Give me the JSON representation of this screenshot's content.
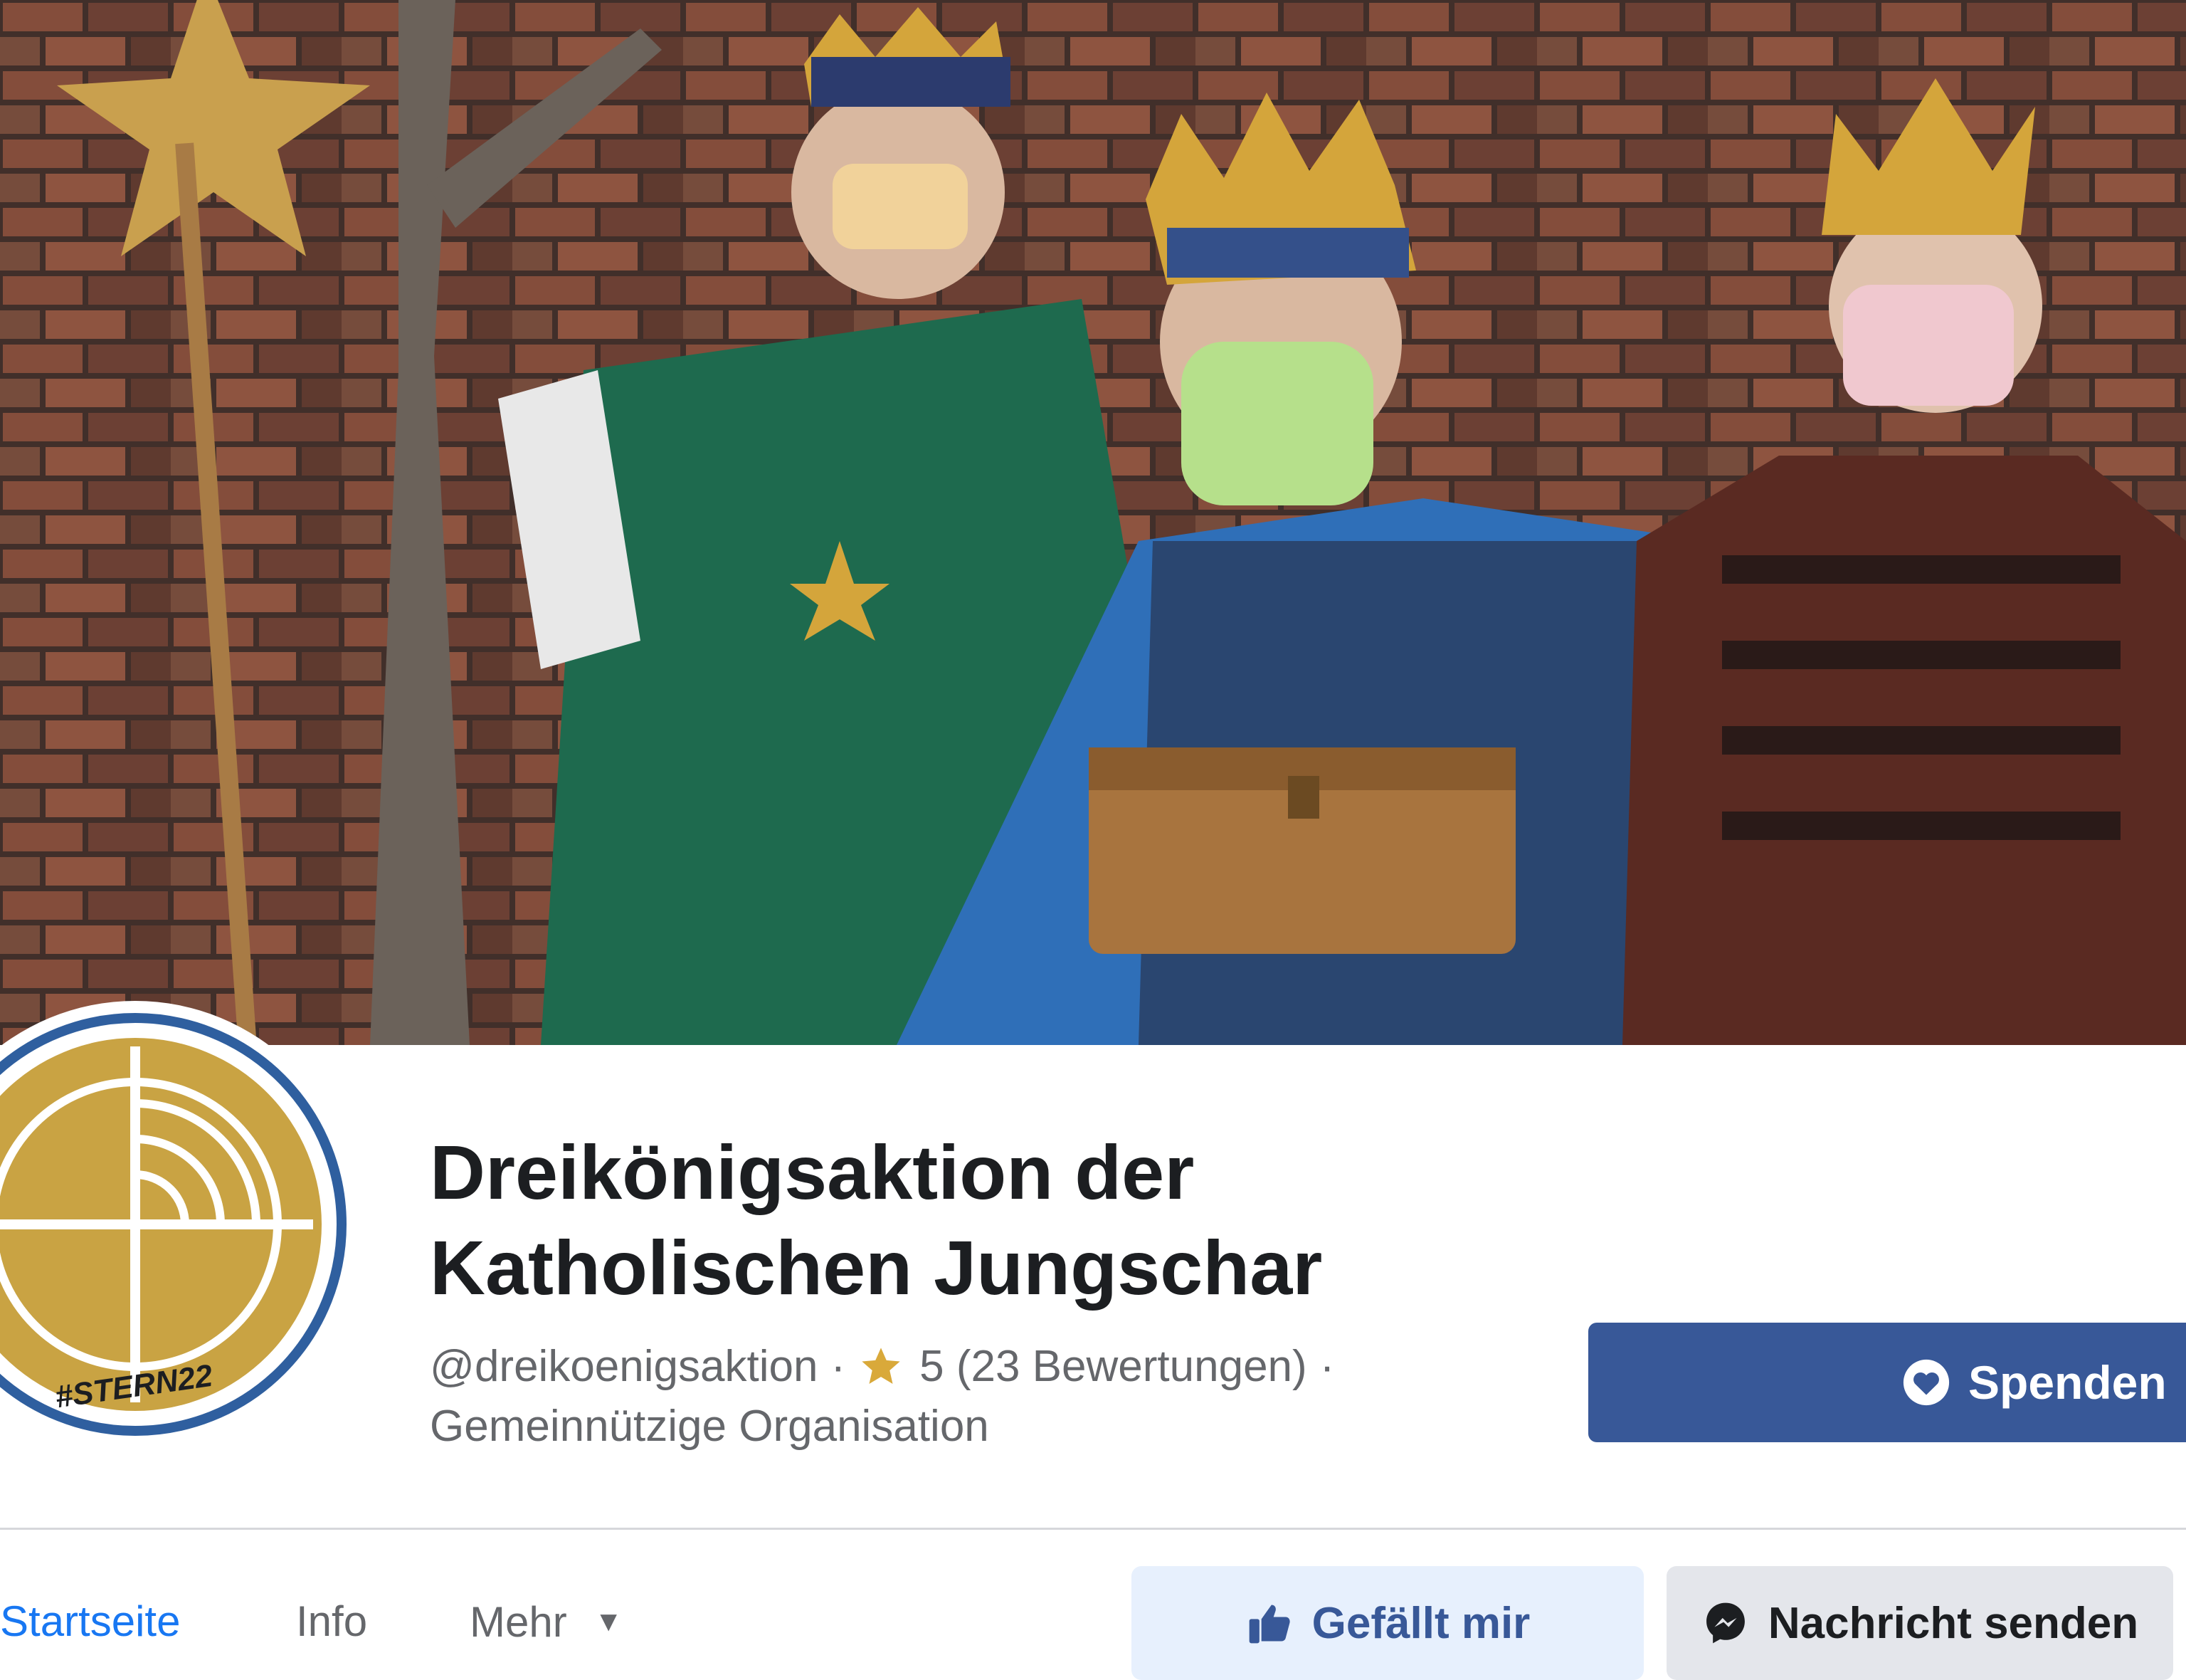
{
  "cover": {
    "scene": "cover-photo"
  },
  "profile": {
    "logo_text": "#STERN22",
    "logo_color": "#c9a343",
    "ring_color": "#2f5f9f"
  },
  "page": {
    "title_line1": "Dreikönigsaktion der",
    "title_line2": "Katholischen Jungschar",
    "handle": "@dreikoenigsaktion",
    "rating": "5 (23 Bewertungen)",
    "separator": "·",
    "category": "Gemeinnützige Organisation"
  },
  "actions": {
    "donate_label": "Spenden",
    "like_label": "Gefällt mir",
    "message_label": "Nachricht senden"
  },
  "tabs": [
    {
      "label": "Startseite",
      "active": true
    },
    {
      "label": "Info",
      "active": false
    },
    {
      "label": "Mehr",
      "active": false
    }
  ],
  "colors": {
    "brand_blue": "#385898",
    "active_tab": "#1877f2",
    "like_bg": "#e7f0fd",
    "message_bg": "#e4e6eb",
    "star": "#d9a93a"
  },
  "icons": {
    "rating": "star-icon",
    "donate": "heart-icon",
    "like": "thumb-icon",
    "message": "messenger-icon",
    "more": "chevron-down-icon"
  }
}
